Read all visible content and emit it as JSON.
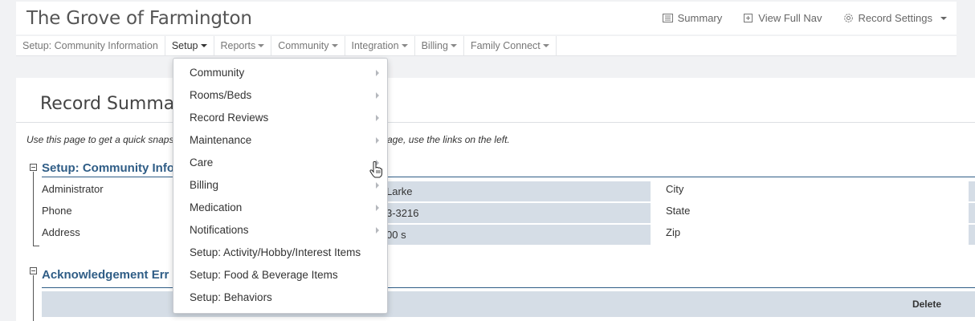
{
  "header": {
    "title": "The Grove of Farmington",
    "actions": [
      {
        "label": "Summary",
        "icon": "list-icon"
      },
      {
        "label": "View Full Nav",
        "icon": "plus-square-icon"
      },
      {
        "label": "Record Settings",
        "icon": "gear-icon"
      }
    ]
  },
  "nav": {
    "items": [
      {
        "label": "Setup: Community Information"
      },
      {
        "label": "Setup"
      },
      {
        "label": "Reports"
      },
      {
        "label": "Community"
      },
      {
        "label": "Integration"
      },
      {
        "label": "Billing"
      },
      {
        "label": "Family Connect"
      }
    ]
  },
  "dropdown": {
    "items": [
      {
        "label": "Community",
        "has_submenu": true
      },
      {
        "label": "Rooms/Beds",
        "has_submenu": true
      },
      {
        "label": "Record Reviews",
        "has_submenu": true
      },
      {
        "label": "Maintenance",
        "has_submenu": true
      },
      {
        "label": "Care",
        "has_submenu": true
      },
      {
        "label": "Billing",
        "has_submenu": true
      },
      {
        "label": "Medication",
        "has_submenu": true
      },
      {
        "label": "Notifications",
        "has_submenu": true
      },
      {
        "label": "Setup: Activity/Hobby/Interest Items",
        "has_submenu": false
      },
      {
        "label": "Setup: Food & Beverage Items",
        "has_submenu": false
      },
      {
        "label": "Setup: Behaviors",
        "has_submenu": false
      }
    ]
  },
  "main": {
    "title": "Record Summary",
    "intro_start": "Use this page to get a quick snapsh",
    "intro_end": "age, use the links on the left."
  },
  "community_info": {
    "section_title": "Setup: Community Info",
    "fields": [
      {
        "label": "Administrator",
        "value": "Larke"
      },
      {
        "label": "Phone",
        "value": "3-3216"
      },
      {
        "label": "Address",
        "value": "00 s"
      }
    ],
    "right_fields": [
      {
        "label": "City"
      },
      {
        "label": "State"
      },
      {
        "label": "Zip"
      }
    ]
  },
  "ack_errors": {
    "section_title": "Acknowledgement Err",
    "columns": {
      "delete": "Delete"
    }
  },
  "colors": {
    "section_title": "#2f5d86",
    "field_bg": "#d5dde6",
    "page_bg": "#f1f2f4"
  }
}
